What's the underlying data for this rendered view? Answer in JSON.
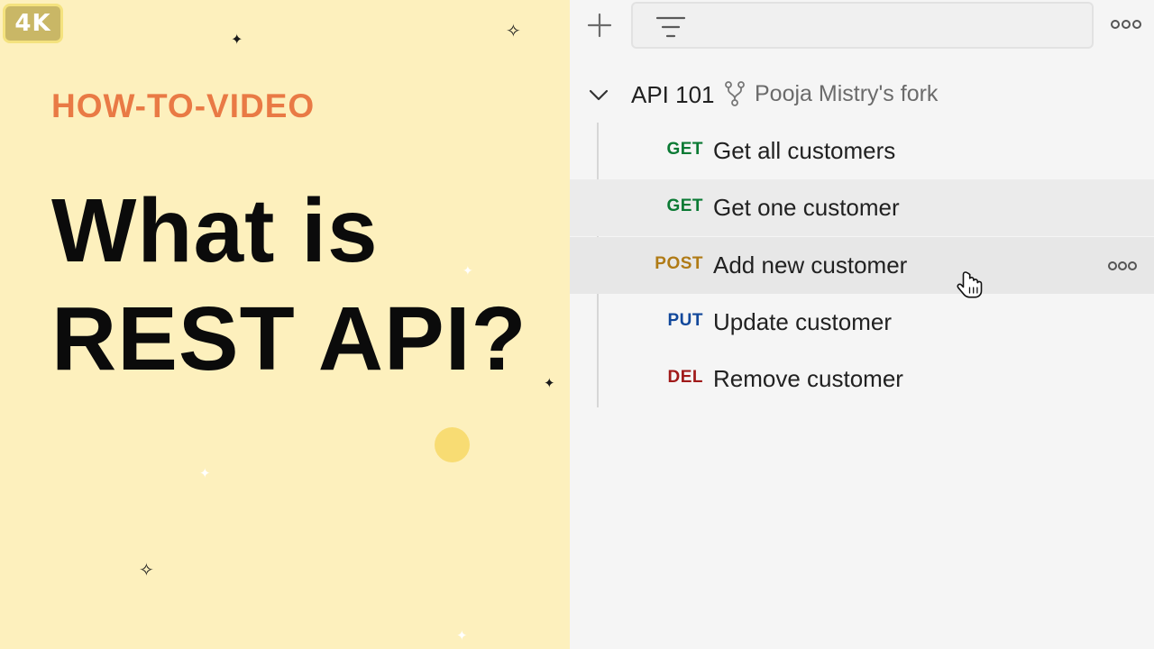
{
  "promo": {
    "badge": "4K",
    "kicker": "HOW-TO-VIDEO",
    "headline_line1": "What is",
    "headline_line2": "REST API?",
    "colors": {
      "background": "#fdf0bd",
      "kicker": "#e97a45",
      "headline": "#0b0b0b",
      "accent_dot": "#f8dc73"
    }
  },
  "toolbar": {
    "new_icon": "plus-icon",
    "filter_icon": "filter-icon",
    "more_icon": "more-horizontal-icon"
  },
  "collection": {
    "name": "API 101",
    "fork_icon": "fork-icon",
    "fork_label": "Pooja Mistry's fork",
    "expanded": true,
    "requests": [
      {
        "method": "GET",
        "name": "Get all customers",
        "method_color": "#0b7a34"
      },
      {
        "method": "GET",
        "name": "Get one customer",
        "method_color": "#0b7a34"
      },
      {
        "method": "POST",
        "name": "Add new customer",
        "method_color": "#b07b16",
        "hovered": true
      },
      {
        "method": "PUT",
        "name": "Update customer",
        "method_color": "#12489b"
      },
      {
        "method": "DEL",
        "name": "Remove customer",
        "method_color": "#a01a1a"
      }
    ]
  }
}
